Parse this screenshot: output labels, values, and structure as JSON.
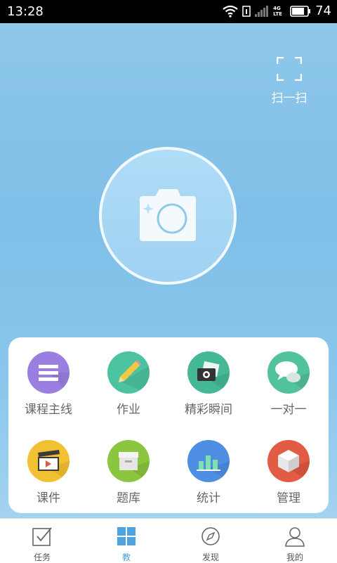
{
  "status_bar": {
    "time": "13:28",
    "network": "4G LTE",
    "battery": "74"
  },
  "scan": {
    "label": "扫一扫"
  },
  "grid": {
    "items": [
      {
        "label": "课程主线",
        "icon": "list-icon",
        "color": "#9b7fe0"
      },
      {
        "label": "作业",
        "icon": "pencil-icon",
        "color": "#4cc3a0"
      },
      {
        "label": "精彩瞬间",
        "icon": "photo-icon",
        "color": "#45b897"
      },
      {
        "label": "一对一",
        "icon": "chat-icon",
        "color": "#52c29a"
      },
      {
        "label": "课件",
        "icon": "clapperboard-icon",
        "color": "#f2c033"
      },
      {
        "label": "题库",
        "icon": "archive-box-icon",
        "color": "#8cc53f"
      },
      {
        "label": "统计",
        "icon": "bar-chart-icon",
        "color": "#4f8fe3"
      },
      {
        "label": "管理",
        "icon": "cube-icon",
        "color": "#e25b45"
      }
    ]
  },
  "tabbar": {
    "tabs": [
      {
        "label": "任务",
        "icon": "checkbox-icon"
      },
      {
        "label": "教",
        "icon": "grid-icon",
        "active": true
      },
      {
        "label": "发现",
        "icon": "compass-icon"
      },
      {
        "label": "我的",
        "icon": "user-icon"
      }
    ]
  },
  "colors": {
    "accent": "#4da3dd",
    "hero_bg": "#80bfe8"
  }
}
